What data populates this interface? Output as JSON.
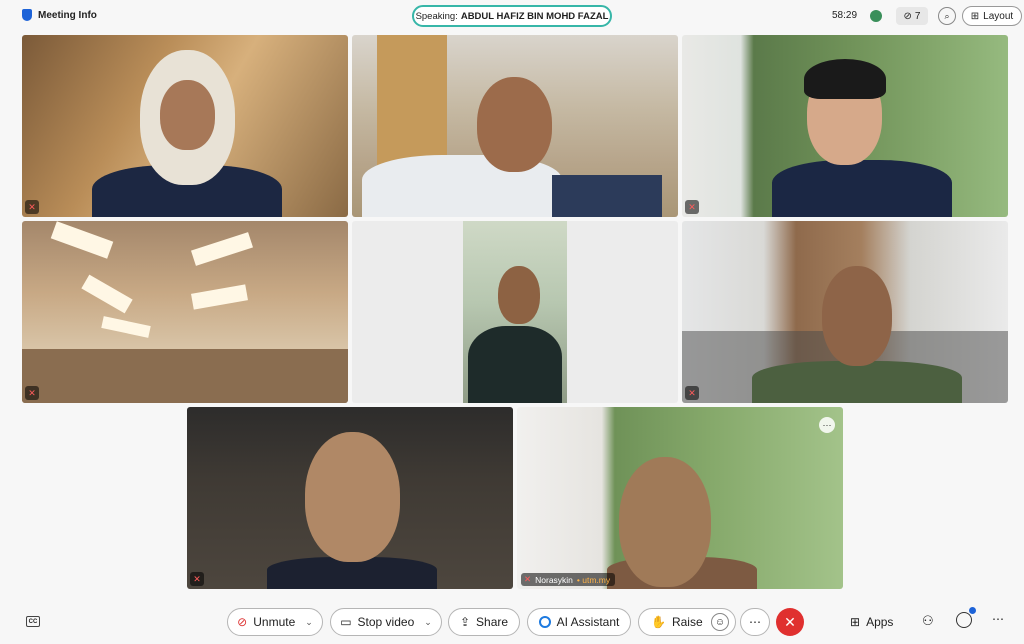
{
  "topbar": {
    "meeting_info_label": "Meeting Info",
    "speaking_prefix": "Speaking:",
    "speaking_name": "ABDUL HAFIZ BIN MOHD FAZAL",
    "timer": "58:29",
    "hidden_count": "7",
    "layout_label": "Layout"
  },
  "tiles": [
    {
      "name": "",
      "muted": true
    },
    {
      "name": "",
      "muted": false
    },
    {
      "name": "",
      "muted": true
    },
    {
      "name": "",
      "muted": true
    },
    {
      "name": "",
      "muted": false
    },
    {
      "name": "",
      "muted": true
    },
    {
      "name": "",
      "muted": true
    },
    {
      "name": "Norasykin",
      "domain": "• utm.my",
      "muted": true
    }
  ],
  "controls": {
    "unmute_label": "Unmute",
    "stop_video_label": "Stop video",
    "share_label": "Share",
    "ai_assistant_label": "AI Assistant",
    "raise_label": "Raise",
    "apps_label": "Apps"
  },
  "icons": {
    "mic_off": "✕",
    "caret": "⌄",
    "more": "⋯",
    "end": "✕",
    "apps": "⊞",
    "people": "⚇",
    "emoji": "☺"
  },
  "colors": {
    "accent": "#1d63d8",
    "speaking_border": "#37b6a8",
    "end_call": "#e0302f",
    "muted": "#ff5c5c"
  }
}
